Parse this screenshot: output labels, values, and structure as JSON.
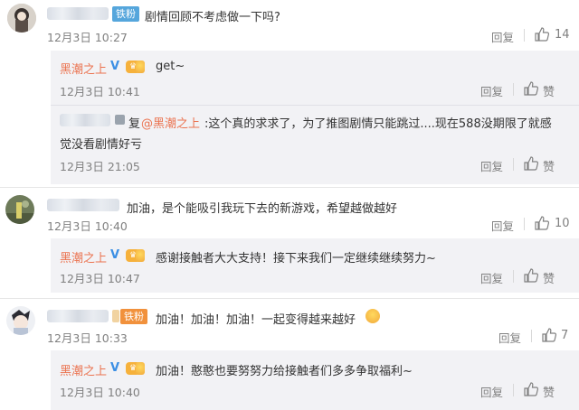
{
  "comments": [
    {
      "text": "剧情回顾不考虑做一下吗?",
      "badge": "铁粉",
      "time": "12月3日 10:27",
      "reply_label": "回复",
      "like_count": "14",
      "replies": [
        {
          "author": "黑潮之上",
          "text": "get~",
          "time": "12月3日 10:41",
          "reply_label": "回复",
          "like_label": "赞"
        },
        {
          "prefix": "复",
          "mention": "@黑潮之上",
          "text_line1": ":这个真的求求了，为了推图剧情只能跳过....现在588没期限了就感",
          "text_line2": "觉没看剧情好亏",
          "time": "12月3日 21:05",
          "reply_label": "回复",
          "like_label": "赞"
        }
      ]
    },
    {
      "text": "加油，是个能吸引我玩下去的新游戏，希望越做越好",
      "time": "12月3日 10:40",
      "reply_label": "回复",
      "like_count": "10",
      "replies": [
        {
          "author": "黑潮之上",
          "text": "感谢接触者大大支持！接下来我们一定继续继续努力~",
          "time": "12月3日 10:47",
          "reply_label": "回复",
          "like_label": "赞"
        }
      ]
    },
    {
      "text": "加油！加油！加油！一起变得越来越好",
      "badge": "铁粉",
      "time": "12月3日 10:33",
      "reply_label": "回复",
      "like_count": "7",
      "replies": [
        {
          "author": "黑潮之上",
          "text": "加油！憨憨也要努努力给接触者们多多争取福利~",
          "time": "12月3日 10:40",
          "reply_label": "回复",
          "like_label": "赞"
        }
      ]
    }
  ],
  "colors": {
    "link": "#eb7350",
    "muted": "#808080",
    "reply_bg": "#f2f2f5",
    "verified": "#3b8fe4"
  }
}
